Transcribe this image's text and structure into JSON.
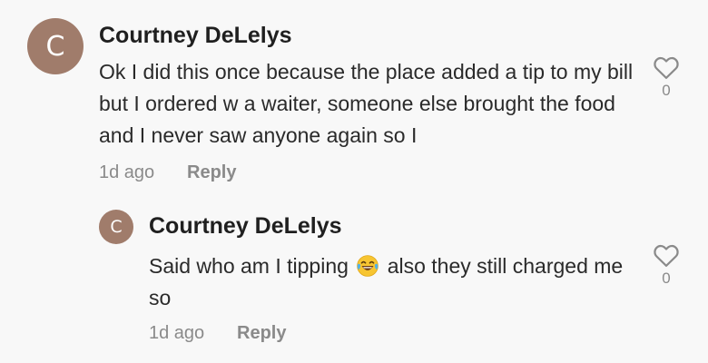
{
  "comments": [
    {
      "avatar_letter": "C",
      "author": "Courtney DeLelys",
      "text": "Ok I did this once because the place added a tip to my bill but I ordered w a waiter, someone else brought the food and I never saw anyone again so I",
      "time": "1d ago",
      "reply_label": "Reply",
      "likes": "0"
    },
    {
      "avatar_letter": "C",
      "author": "Courtney DeLelys",
      "text_before_emoji": "Said who am I tipping",
      "emoji": "face-with-tears-of-joy-icon",
      "text_after_emoji": "also they still charged me so",
      "time": "1d ago",
      "reply_label": "Reply",
      "likes": "0"
    }
  ],
  "colors": {
    "background": "#f8f8f8",
    "avatar": "#a07c6b",
    "author": "#1f1f1f",
    "text": "#2a2a2a",
    "muted": "#8a8a8a"
  }
}
